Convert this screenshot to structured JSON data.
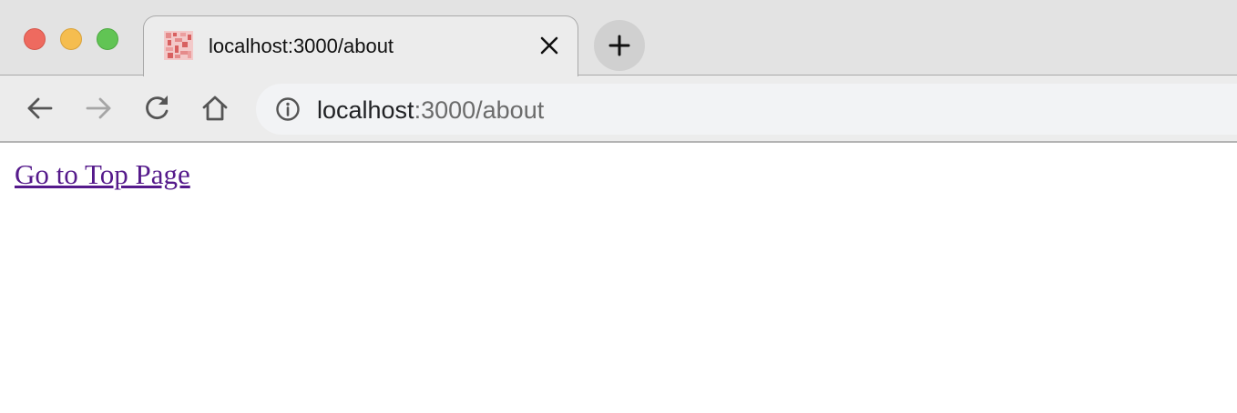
{
  "window": {
    "traffic_lights": [
      "close",
      "minimize",
      "maximize"
    ]
  },
  "tab": {
    "title": "localhost:3000/about",
    "favicon": "pixel-favicon-icon",
    "close_icon": "close-icon"
  },
  "new_tab": {
    "icon": "plus-icon"
  },
  "toolbar": {
    "back_icon": "arrow-left-icon",
    "forward_icon": "arrow-right-icon",
    "reload_icon": "reload-icon",
    "home_icon": "home-icon"
  },
  "address_bar": {
    "info_icon": "info-icon",
    "host": "localhost",
    "path": ":3000/about"
  },
  "page": {
    "link_text": "Go to Top Page",
    "link_color": "#551a8b"
  },
  "colors": {
    "tabstrip_bg": "#e3e3e3",
    "toolbar_bg": "#ececec",
    "omnibox_bg": "#f2f3f5",
    "traffic_close": "#ee6a5f",
    "traffic_min": "#f5bd4f",
    "traffic_max": "#61c454"
  }
}
